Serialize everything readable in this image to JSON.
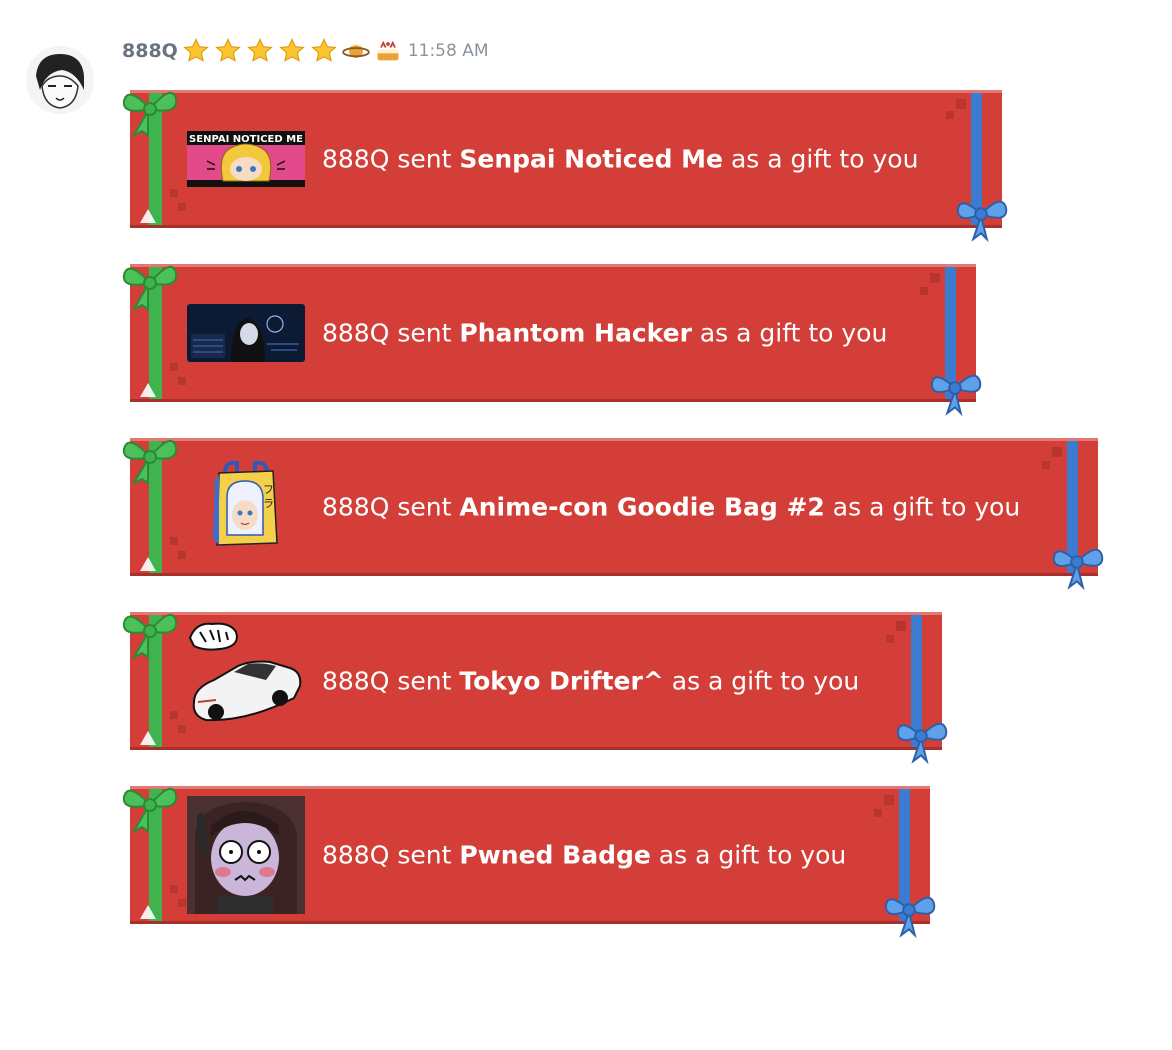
{
  "message": {
    "username": "888Q",
    "badges": [
      "star-icon",
      "star-icon",
      "star-icon",
      "star-icon",
      "star-icon",
      "saturn-icon",
      "cake-icon"
    ],
    "timestamp": "11:58 AM"
  },
  "gifts": [
    {
      "sender": "888Q",
      "verb": "sent",
      "item": "Senpai Noticed Me",
      "suffix": "as a gift to you",
      "thumbnail_text": "SENPAI NOTICED ME",
      "thumbnail": "anime-face-banner"
    },
    {
      "sender": "888Q",
      "verb": "sent",
      "item": "Phantom Hacker",
      "suffix": "as a gift to you",
      "thumbnail": "hacker-scene"
    },
    {
      "sender": "888Q",
      "verb": "sent",
      "item": "Anime-con Goodie Bag #2",
      "suffix": "as a gift to you",
      "thumbnail": "goodie-bag"
    },
    {
      "sender": "888Q",
      "verb": "sent",
      "item": "Tokyo Drifter^",
      "suffix": "as a gift to you",
      "thumbnail": "white-car"
    },
    {
      "sender": "888Q",
      "verb": "sent",
      "item": "Pwned Badge",
      "suffix": "as a gift to you",
      "thumbnail": "shocked-girl"
    }
  ],
  "colors": {
    "card": "#d33f38",
    "green_ribbon": "#3fb34d",
    "blue_ribbon": "#3b7bd0",
    "username": "#6a7380"
  }
}
